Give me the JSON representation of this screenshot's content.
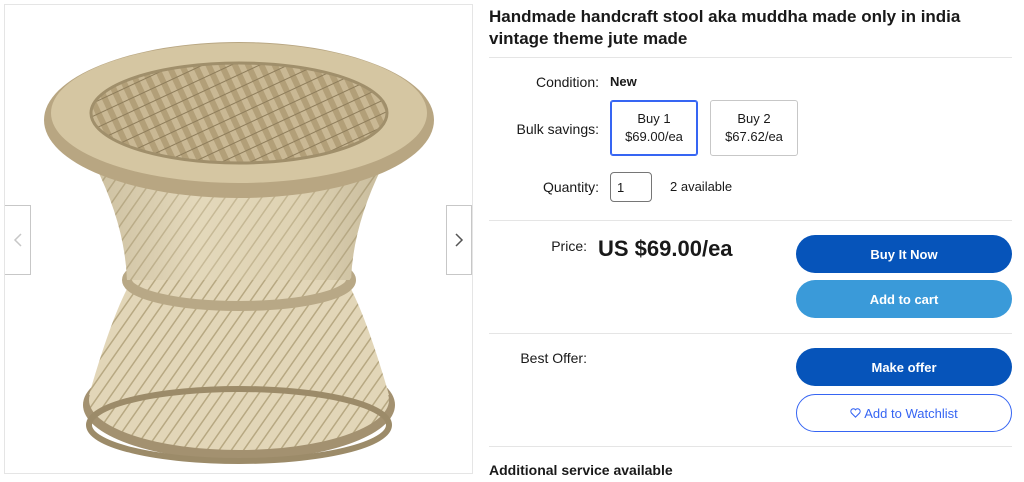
{
  "product": {
    "title": "Handmade handcraft stool aka muddha made only in india vintage theme jute made",
    "image_alt": "Woven jute and cane stool"
  },
  "condition": {
    "label": "Condition:",
    "value": "New"
  },
  "bulk_savings": {
    "label": "Bulk savings:",
    "options": [
      {
        "qty": "Buy 1",
        "price": "$69.00/ea",
        "selected": true
      },
      {
        "qty": "Buy 2",
        "price": "$67.62/ea",
        "selected": false
      }
    ]
  },
  "quantity": {
    "label": "Quantity:",
    "value": "1",
    "available": "2 available"
  },
  "price": {
    "label": "Price:",
    "value": "US $69.00/ea"
  },
  "buttons": {
    "buy_now": "Buy It Now",
    "add_to_cart": "Add to cart",
    "make_offer": "Make offer",
    "watchlist": "Add to Watchlist"
  },
  "best_offer": {
    "label": "Best Offer:"
  },
  "additional_service": "Additional service available",
  "colors": {
    "primary": "#0654ba",
    "secondary": "#3a9ad9",
    "accent": "#3665f3"
  }
}
